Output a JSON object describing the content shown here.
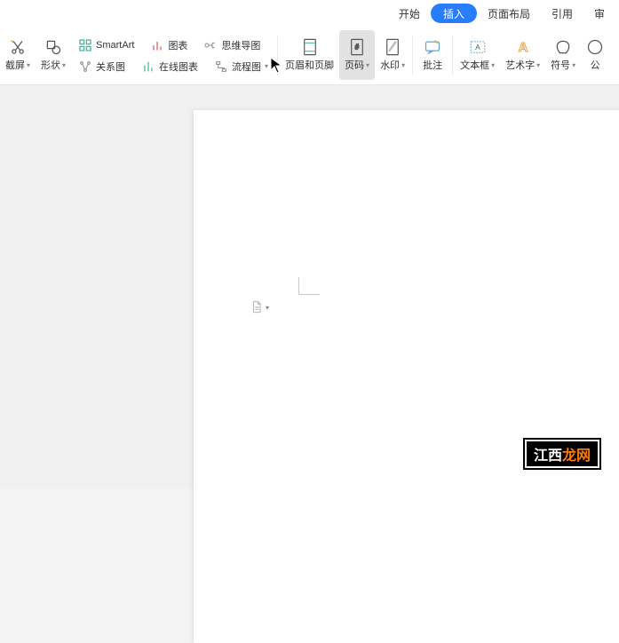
{
  "tabs": {
    "start": "开始",
    "insert": "插入",
    "layout": "页面布局",
    "reference": "引用",
    "last_partial": "审"
  },
  "ribbon": {
    "screenshot": "截屏",
    "shapes": "形状",
    "smartart": "SmartArt",
    "chart": "图表",
    "relation": "关系图",
    "mindmap": "思维导图",
    "online_chart": "在线图表",
    "flowchart": "流程图",
    "header_footer": "页眉和页脚",
    "page_number": "页码",
    "watermark": "水印",
    "comment": "批注",
    "textbox": "文本框",
    "wordart": "艺术字",
    "symbol": "符号",
    "eq_partial": "公"
  },
  "watermark_text": {
    "part1": "江西",
    "part2": "龙网"
  }
}
